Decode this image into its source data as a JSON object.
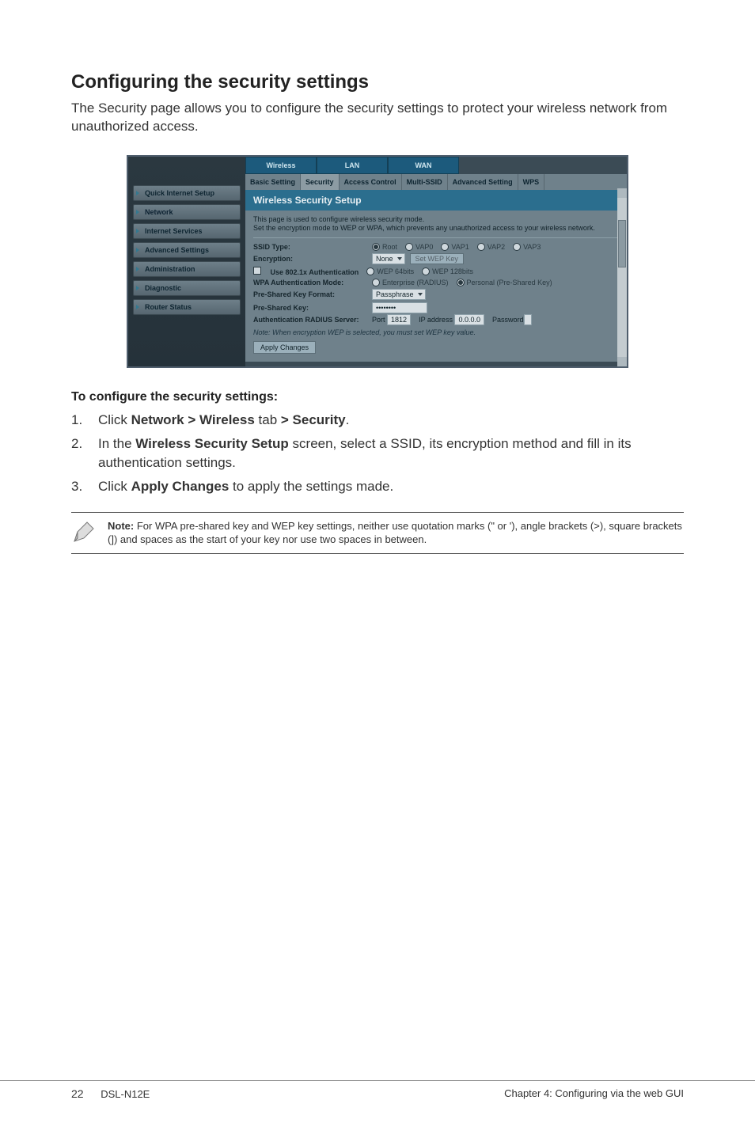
{
  "title": "Configuring the security settings",
  "intro": "The Security page allows you to configure the security settings to protect your wireless network from unauthorized access.",
  "screenshot": {
    "sidebar": [
      "Quick Internet Setup",
      "Network",
      "Internet Services",
      "Advanced Settings",
      "Administration",
      "Diagnostic",
      "Router Status"
    ],
    "tabs1": [
      "Wireless",
      "LAN",
      "WAN"
    ],
    "tabs2": [
      "Basic Setting",
      "Security",
      "Access Control",
      "Multi-SSID",
      "Advanced Setting",
      "WPS"
    ],
    "panel_title": "Wireless Security Setup",
    "panel_desc": "This page is used to configure wireless security mode.\nSet the encryption mode to WEP or WPA, which prevents any unauthorized access to your wireless network.",
    "rows": {
      "ssid_type_label": "SSID Type:",
      "ssid_opts": [
        "Root",
        "VAP0",
        "VAP1",
        "VAP2",
        "VAP3"
      ],
      "encryption_label": "Encryption:",
      "encryption_value": "None",
      "set_wep_btn": "Set WEP Key",
      "use8021x_label": "Use 802.1x Authentication",
      "wep_opts": [
        "WEP 64bits",
        "WEP 128bits"
      ],
      "wpa_mode_label": "WPA Authentication Mode:",
      "wpa_opts": [
        "Enterprise (RADIUS)",
        "Personal (Pre-Shared Key)"
      ],
      "psk_format_label": "Pre-Shared Key Format:",
      "psk_format_value": "Passphrase",
      "psk_label": "Pre-Shared Key:",
      "psk_value": "••••••••",
      "radius_label": "Authentication RADIUS Server:",
      "radius_port_label": "Port",
      "radius_port_value": "1812",
      "radius_ip_label": "IP address",
      "radius_ip_value": "0.0.0.0",
      "radius_pw_label": "Password"
    },
    "panel_note": "Note: When encryption WEP is selected, you must set WEP key value.",
    "apply_btn": "Apply Changes"
  },
  "subhead": "To configure the security settings:",
  "steps": [
    {
      "n": "1.",
      "pre": "Click ",
      "bold": "Network > Wireless",
      "mid": " tab ",
      "bold2": "> Security",
      "post": "."
    },
    {
      "n": "2.",
      "pre": "In the ",
      "bold": "Wireless Security Setup",
      "mid": " screen, select a SSID, its encryption method and fill in its authentication settings.",
      "bold2": "",
      "post": ""
    },
    {
      "n": "3.",
      "pre": "Click ",
      "bold": "Apply Changes",
      "mid": " to apply the settings made.",
      "bold2": "",
      "post": ""
    }
  ],
  "note": {
    "lead": "Note:",
    "body": " For WPA pre-shared key and WEP key settings, neither use quotation marks (\" or '), angle brackets (>), square brackets (]) and spaces as the start of your key nor use two spaces in between."
  },
  "footer": {
    "page": "22",
    "model": "DSL-N12E",
    "chapter": "Chapter 4: Configuring via the web GUI"
  }
}
